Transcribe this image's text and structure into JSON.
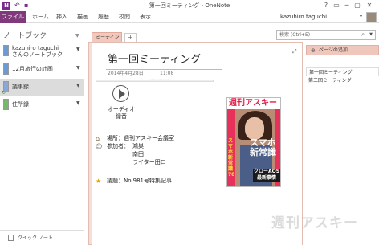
{
  "window": {
    "title": "第一回ミーティング - OneNote",
    "quick_access": [
      "↶",
      "▪"
    ],
    "controls": [
      "?",
      "▭",
      "─",
      "▢",
      "✕"
    ]
  },
  "ribbon": {
    "tabs": [
      "ファイル",
      "ホーム",
      "挿入",
      "描画",
      "履歴",
      "校閲",
      "表示"
    ],
    "user": "kazuhiro taguchi"
  },
  "notebooks": {
    "header": "ノートブック",
    "items": [
      {
        "label_line1": "kazuhiro taguchi",
        "label_line2": "さんのノートブック",
        "color": "#6b9ad6"
      },
      {
        "label_line1": "12月旅行の計画",
        "label_line2": "",
        "color": "#6b9ad6"
      },
      {
        "label_line1": "議事録",
        "label_line2": "",
        "color": "#8aa7d6"
      },
      {
        "label_line1": "住所録",
        "label_line2": "",
        "color": "#78b86a"
      }
    ],
    "quick_notes": "クイック ノート"
  },
  "sections": {
    "tabs": [
      "ミーティング"
    ],
    "add_tab": "+"
  },
  "search": {
    "placeholder": "検索 (Ctrl+E)"
  },
  "page": {
    "title": "第一回ミーティング",
    "date": "2014年4月28日",
    "time": "11:08",
    "audio_label_line1": "オーディオ",
    "audio_label_line2": "録音",
    "place": "場所：週刊アスキー会議室",
    "attendees_label": "参加者：",
    "attendees": [
      "鴻巣",
      "南田",
      "ライター田口"
    ],
    "agenda": "議題：No.981号特集記事"
  },
  "magazine": {
    "masthead": "週刊アスキー",
    "headline": "スマホ新常識",
    "side_text": "スマホ新常識70",
    "feature": "クローAOS最新事情"
  },
  "pages_panel": {
    "add_page": "ページの追加",
    "pages": [
      "第一回ミーティング",
      "第二回ミーティング"
    ]
  },
  "watermark": "週刊アスキー",
  "colors": {
    "onenote_purple": "#80397b",
    "section_pink": "#f2c8bd",
    "selected_notebook_bg": "#dcdcdc"
  }
}
